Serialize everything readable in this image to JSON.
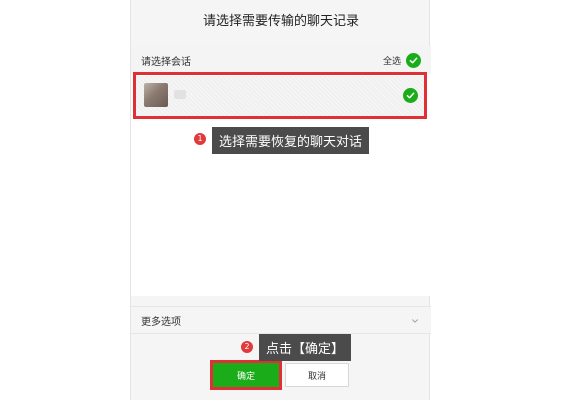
{
  "dialog": {
    "title": "请选择需要传输的聊天记录"
  },
  "list": {
    "header_label": "请选择会话",
    "select_all_label": "全选",
    "items": [
      {
        "selected": true
      }
    ]
  },
  "annotations": {
    "step1": {
      "number": "1",
      "text": "选择需要恢复的聊天对话"
    },
    "step2": {
      "number": "2",
      "text": "点击【确定】"
    }
  },
  "more_options": {
    "label": "更多选项",
    "icon": "chevron-down-icon"
  },
  "buttons": {
    "confirm_label": "确定",
    "cancel_label": "取消"
  },
  "colors": {
    "accent_green": "#1aad19",
    "highlight_red": "#e02f35",
    "tooltip_bg": "#4b4b4b"
  }
}
